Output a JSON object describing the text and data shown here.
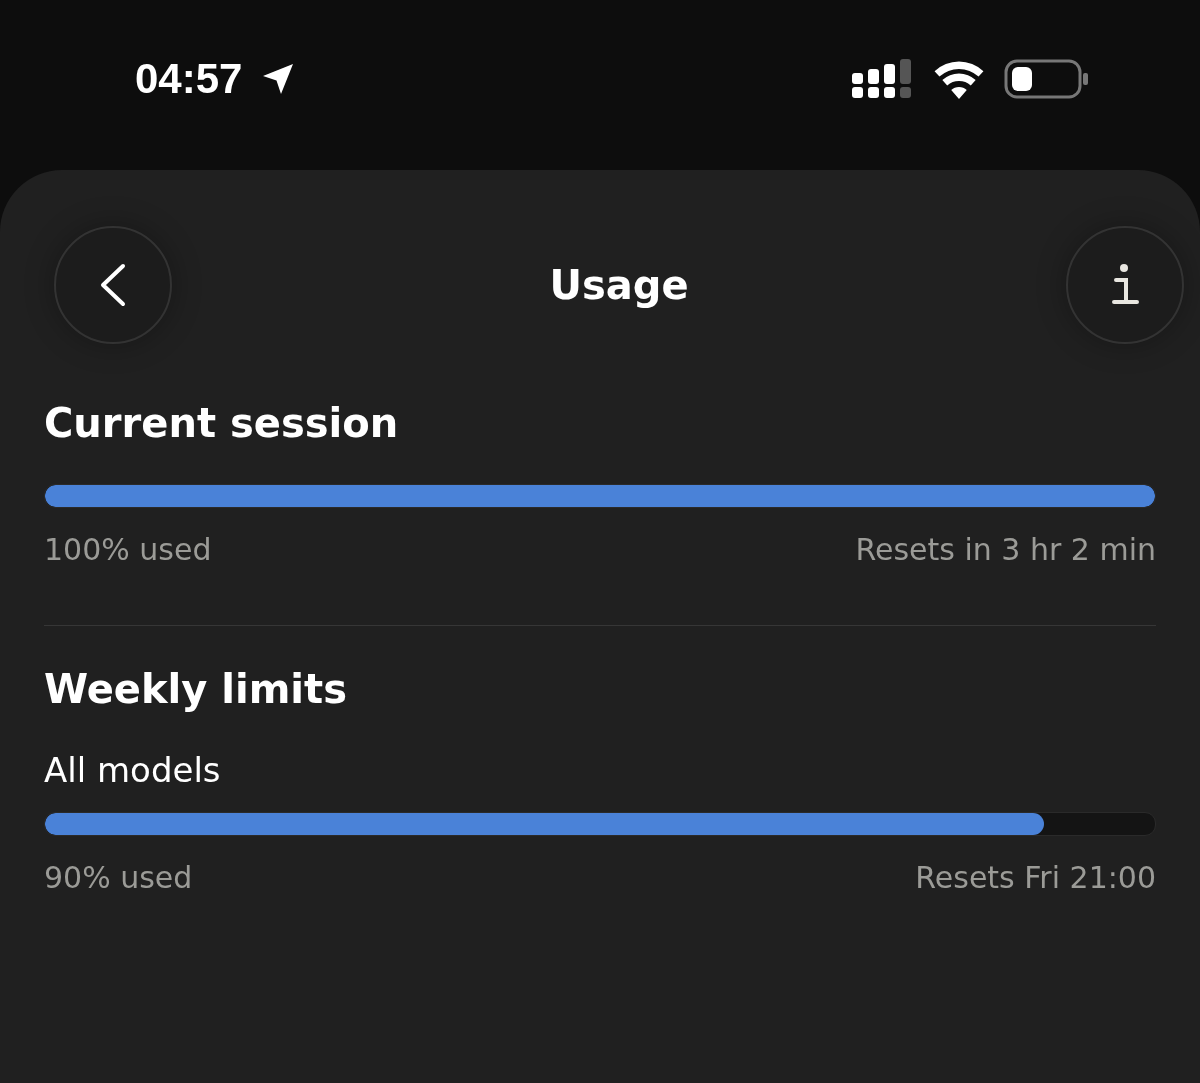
{
  "status_bar": {
    "time": "04:57"
  },
  "header": {
    "title": "Usage"
  },
  "sections": [
    {
      "title": "Current session",
      "meters": [
        {
          "level": 1.0,
          "used": "100% used",
          "resets": "Resets in 3 hr 2 min"
        }
      ]
    },
    {
      "title": "Weekly limits",
      "meters": [
        {
          "label": "All models",
          "level": 0.9,
          "used": "90% used",
          "resets": "Resets Fri 21:00"
        }
      ]
    }
  ]
}
